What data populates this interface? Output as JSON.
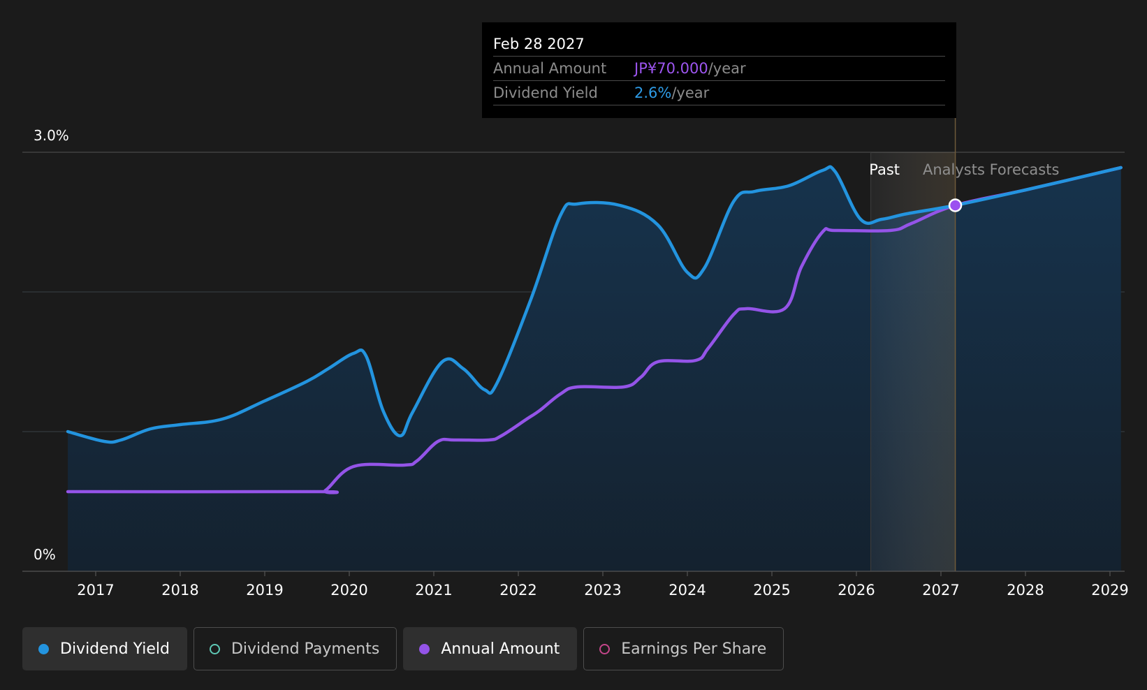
{
  "chart_data": {
    "type": "line",
    "x_axis": {
      "type": "year",
      "tick_labels": [
        "2017",
        "2018",
        "2019",
        "2020",
        "2021",
        "2022",
        "2023",
        "2024",
        "2025",
        "2026",
        "2027",
        "2028",
        "2029"
      ],
      "range": [
        2016.0,
        2029.13
      ]
    },
    "y_axis": {
      "labels": [
        "3.0%",
        "0%"
      ],
      "range_percent": [
        0,
        3.0
      ]
    },
    "grid": "horizontal",
    "regions": {
      "past_label": "Past",
      "forecast_label": "Analysts Forecasts",
      "past_end_year": 2026.17
    },
    "highlight_point_year": 2027.17,
    "series": [
      {
        "name": "Dividend Yield",
        "color": "#2394df",
        "unit": "%",
        "points": [
          [
            2016.67,
            1.0
          ],
          [
            2017.1,
            0.93
          ],
          [
            2017.3,
            0.94
          ],
          [
            2017.65,
            1.02
          ],
          [
            2018.0,
            1.05
          ],
          [
            2018.5,
            1.09
          ],
          [
            2019.0,
            1.22
          ],
          [
            2019.5,
            1.36
          ],
          [
            2019.75,
            1.45
          ],
          [
            2020.05,
            1.56
          ],
          [
            2020.2,
            1.54
          ],
          [
            2020.4,
            1.15
          ],
          [
            2020.6,
            0.97
          ],
          [
            2020.75,
            1.14
          ],
          [
            2021.1,
            1.5
          ],
          [
            2021.35,
            1.45
          ],
          [
            2021.6,
            1.3
          ],
          [
            2021.75,
            1.35
          ],
          [
            2022.15,
            1.95
          ],
          [
            2022.5,
            2.55
          ],
          [
            2022.7,
            2.63
          ],
          [
            2023.2,
            2.62
          ],
          [
            2023.65,
            2.48
          ],
          [
            2024.0,
            2.14
          ],
          [
            2024.2,
            2.17
          ],
          [
            2024.55,
            2.65
          ],
          [
            2024.8,
            2.72
          ],
          [
            2025.2,
            2.76
          ],
          [
            2025.6,
            2.87
          ],
          [
            2025.75,
            2.86
          ],
          [
            2026.05,
            2.52
          ],
          [
            2026.3,
            2.52
          ],
          [
            2026.6,
            2.56
          ],
          [
            2027.17,
            2.62
          ],
          [
            2028.0,
            2.73
          ],
          [
            2029.13,
            2.89
          ]
        ]
      },
      {
        "name": "Annual Amount",
        "color": "#9454e8",
        "unit": "JP¥",
        "points": [
          [
            2016.67,
            0.57
          ],
          [
            2019.6,
            0.57
          ],
          [
            2019.72,
            0.58
          ],
          [
            2020.05,
            0.75
          ],
          [
            2020.65,
            0.76
          ],
          [
            2020.8,
            0.79
          ],
          [
            2021.05,
            0.93
          ],
          [
            2021.25,
            0.94
          ],
          [
            2021.65,
            0.94
          ],
          [
            2021.8,
            0.97
          ],
          [
            2022.1,
            1.09
          ],
          [
            2022.25,
            1.15
          ],
          [
            2022.5,
            1.27
          ],
          [
            2022.7,
            1.32
          ],
          [
            2023.25,
            1.32
          ],
          [
            2023.45,
            1.39
          ],
          [
            2023.65,
            1.5
          ],
          [
            2024.1,
            1.51
          ],
          [
            2024.25,
            1.6
          ],
          [
            2024.55,
            1.84
          ],
          [
            2024.7,
            1.88
          ],
          [
            2025.15,
            1.88
          ],
          [
            2025.35,
            2.18
          ],
          [
            2025.6,
            2.43
          ],
          [
            2025.75,
            2.44
          ],
          [
            2026.4,
            2.44
          ],
          [
            2026.65,
            2.49
          ],
          [
            2027.17,
            2.62
          ],
          [
            2028.0,
            2.73
          ],
          [
            2029.13,
            2.89
          ]
        ]
      }
    ]
  },
  "tooltip": {
    "date": "Feb 28 2027",
    "rows": [
      {
        "label": "Annual Amount",
        "value": "JP¥70.000",
        "unit": "/year",
        "color": "#9d55f0"
      },
      {
        "label": "Dividend Yield",
        "value": "2.6%",
        "unit": "/year",
        "color": "#2e9be6"
      }
    ]
  },
  "legend": [
    {
      "label": "Dividend Yield",
      "color": "#2394df",
      "active": true
    },
    {
      "label": "Dividend Payments",
      "color": "#5fc9b6",
      "active": false
    },
    {
      "label": "Annual Amount",
      "color": "#9454e8",
      "active": true
    },
    {
      "label": "Earnings Per Share",
      "color": "#c4468a",
      "active": false
    }
  ]
}
